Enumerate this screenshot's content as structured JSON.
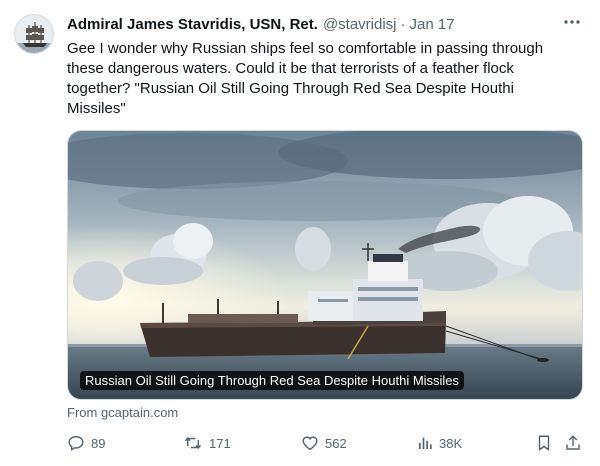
{
  "author": {
    "name": "Admiral James Stavridis, USN, Ret.",
    "handle": "@stavridisj",
    "separator": "·",
    "date": "Jan 17"
  },
  "tweet": {
    "text": "Gee I wonder why Russian ships feel so comfortable in passing through these dangerous waters. Could it be that terrorists of a feather flock together? \"Russian Oil Still Going Through Red Sea Despite Houthi Missiles\""
  },
  "card": {
    "headline": "Russian Oil Still Going Through Red Sea Despite Houthi Missiles",
    "source": "From gcaptain.com",
    "image_icon": "oil-tanker-photo"
  },
  "actions": {
    "replies": "89",
    "reposts": "171",
    "likes": "562",
    "views": "38K"
  },
  "icons": [
    "more-icon",
    "reply-icon",
    "repost-icon",
    "like-icon",
    "views-icon",
    "bookmark-icon",
    "share-icon"
  ],
  "colors": {
    "secondary_text": "#536471",
    "primary_text": "#0f1419",
    "card_border": "#cfd9de"
  }
}
